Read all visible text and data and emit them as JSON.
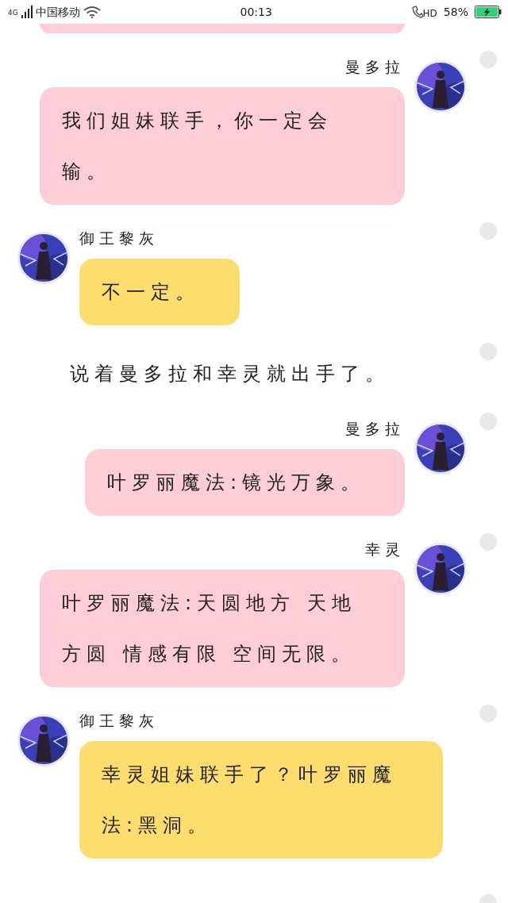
{
  "status_bar": {
    "network": "4G",
    "carrier": "中国移动",
    "time": "00:13",
    "call_badge": "HD",
    "battery": "58%",
    "charging": true
  },
  "previous_bubble": {
    "color": "#fdcdd8"
  },
  "messages": [
    {
      "kind": "sent",
      "sender": "曼多拉",
      "text": "我们姐妹联手，你一定会输。",
      "color": "#fdcdd8",
      "selected": false
    },
    {
      "kind": "received",
      "sender": "御王黎灰",
      "text": "不一定。",
      "color": "#fedd6f",
      "selected": false
    },
    {
      "kind": "narration",
      "text": "说着曼多拉和幸灵就出手了。",
      "selected": false
    },
    {
      "kind": "sent",
      "sender": "曼多拉",
      "text": "叶罗丽魔法:镜光万象。",
      "color": "#fdcdd8",
      "selected": false
    },
    {
      "kind": "sent",
      "sender": "幸灵",
      "text": "叶罗丽魔法:天圆地方 天地方圆 情感有限 空间无限。",
      "color": "#fdcdd8",
      "selected": false
    },
    {
      "kind": "received",
      "sender": "御王黎灰",
      "text": "幸灵姐妹联手了？叶罗丽魔法:黑洞。",
      "color": "#fedd6f",
      "selected": false
    }
  ],
  "next_item": {
    "selected": false
  }
}
